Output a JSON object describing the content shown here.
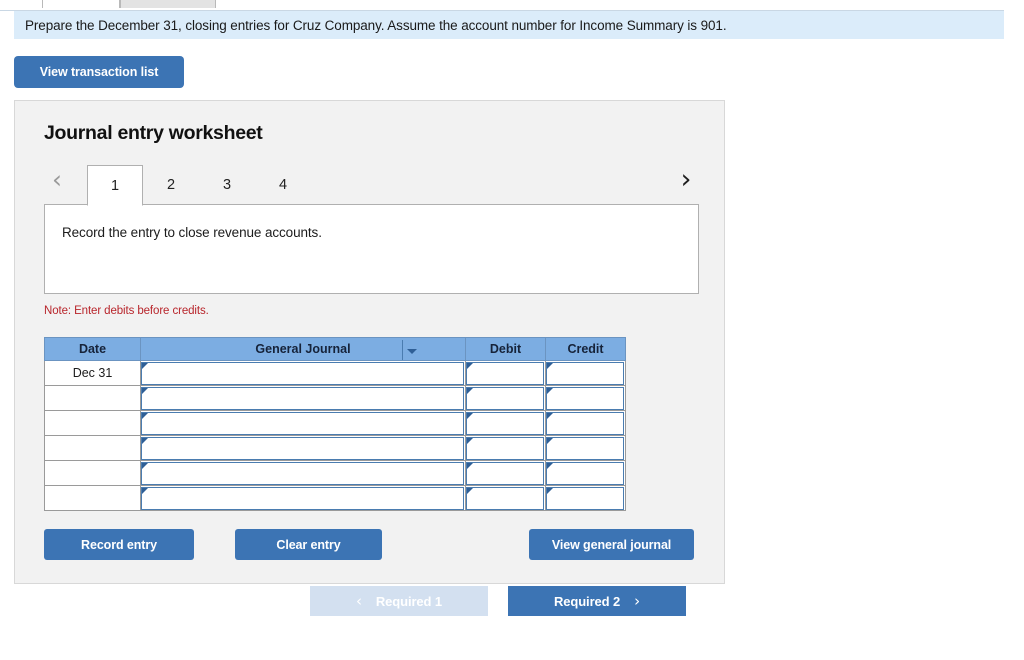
{
  "instruction": {
    "text": "Prepare the December 31, closing entries for Cruz Company. Assume the account number for Income Summary is 901."
  },
  "toolbar": {
    "view_transaction_list_label": "View transaction list"
  },
  "worksheet": {
    "title": "Journal entry worksheet",
    "prev_icon": "‹",
    "next_icon": "›",
    "tabs": [
      {
        "label": "1",
        "active": true
      },
      {
        "label": "2",
        "active": false
      },
      {
        "label": "3",
        "active": false
      },
      {
        "label": "4",
        "active": false
      }
    ],
    "prompt": "Record the entry to close revenue accounts.",
    "note": "Note: Enter debits before credits."
  },
  "journal_table": {
    "headers": [
      "Date",
      "General Journal",
      "Debit",
      "Credit"
    ],
    "rows": [
      {
        "date": "Dec 31",
        "general_journal": "",
        "debit": "",
        "credit": ""
      },
      {
        "date": "",
        "general_journal": "",
        "debit": "",
        "credit": ""
      },
      {
        "date": "",
        "general_journal": "",
        "debit": "",
        "credit": ""
      },
      {
        "date": "",
        "general_journal": "",
        "debit": "",
        "credit": ""
      },
      {
        "date": "",
        "general_journal": "",
        "debit": "",
        "credit": ""
      },
      {
        "date": "",
        "general_journal": "",
        "debit": "",
        "credit": ""
      }
    ]
  },
  "actions": {
    "record_entry_label": "Record entry",
    "clear_entry_label": "Clear entry",
    "view_general_journal_label": "View general journal"
  },
  "required_nav": {
    "prev_label": "Required 1",
    "prev_icon": "‹",
    "next_label": "Required 2",
    "next_icon": "›"
  },
  "colors": {
    "accent_blue": "#3c74b4",
    "header_blue": "#7cadE2",
    "banner_blue": "#dbecfa",
    "disabled_blue": "#d3e0f0",
    "note_red": "#b8252b",
    "panel_gray": "#f2f2f2"
  }
}
